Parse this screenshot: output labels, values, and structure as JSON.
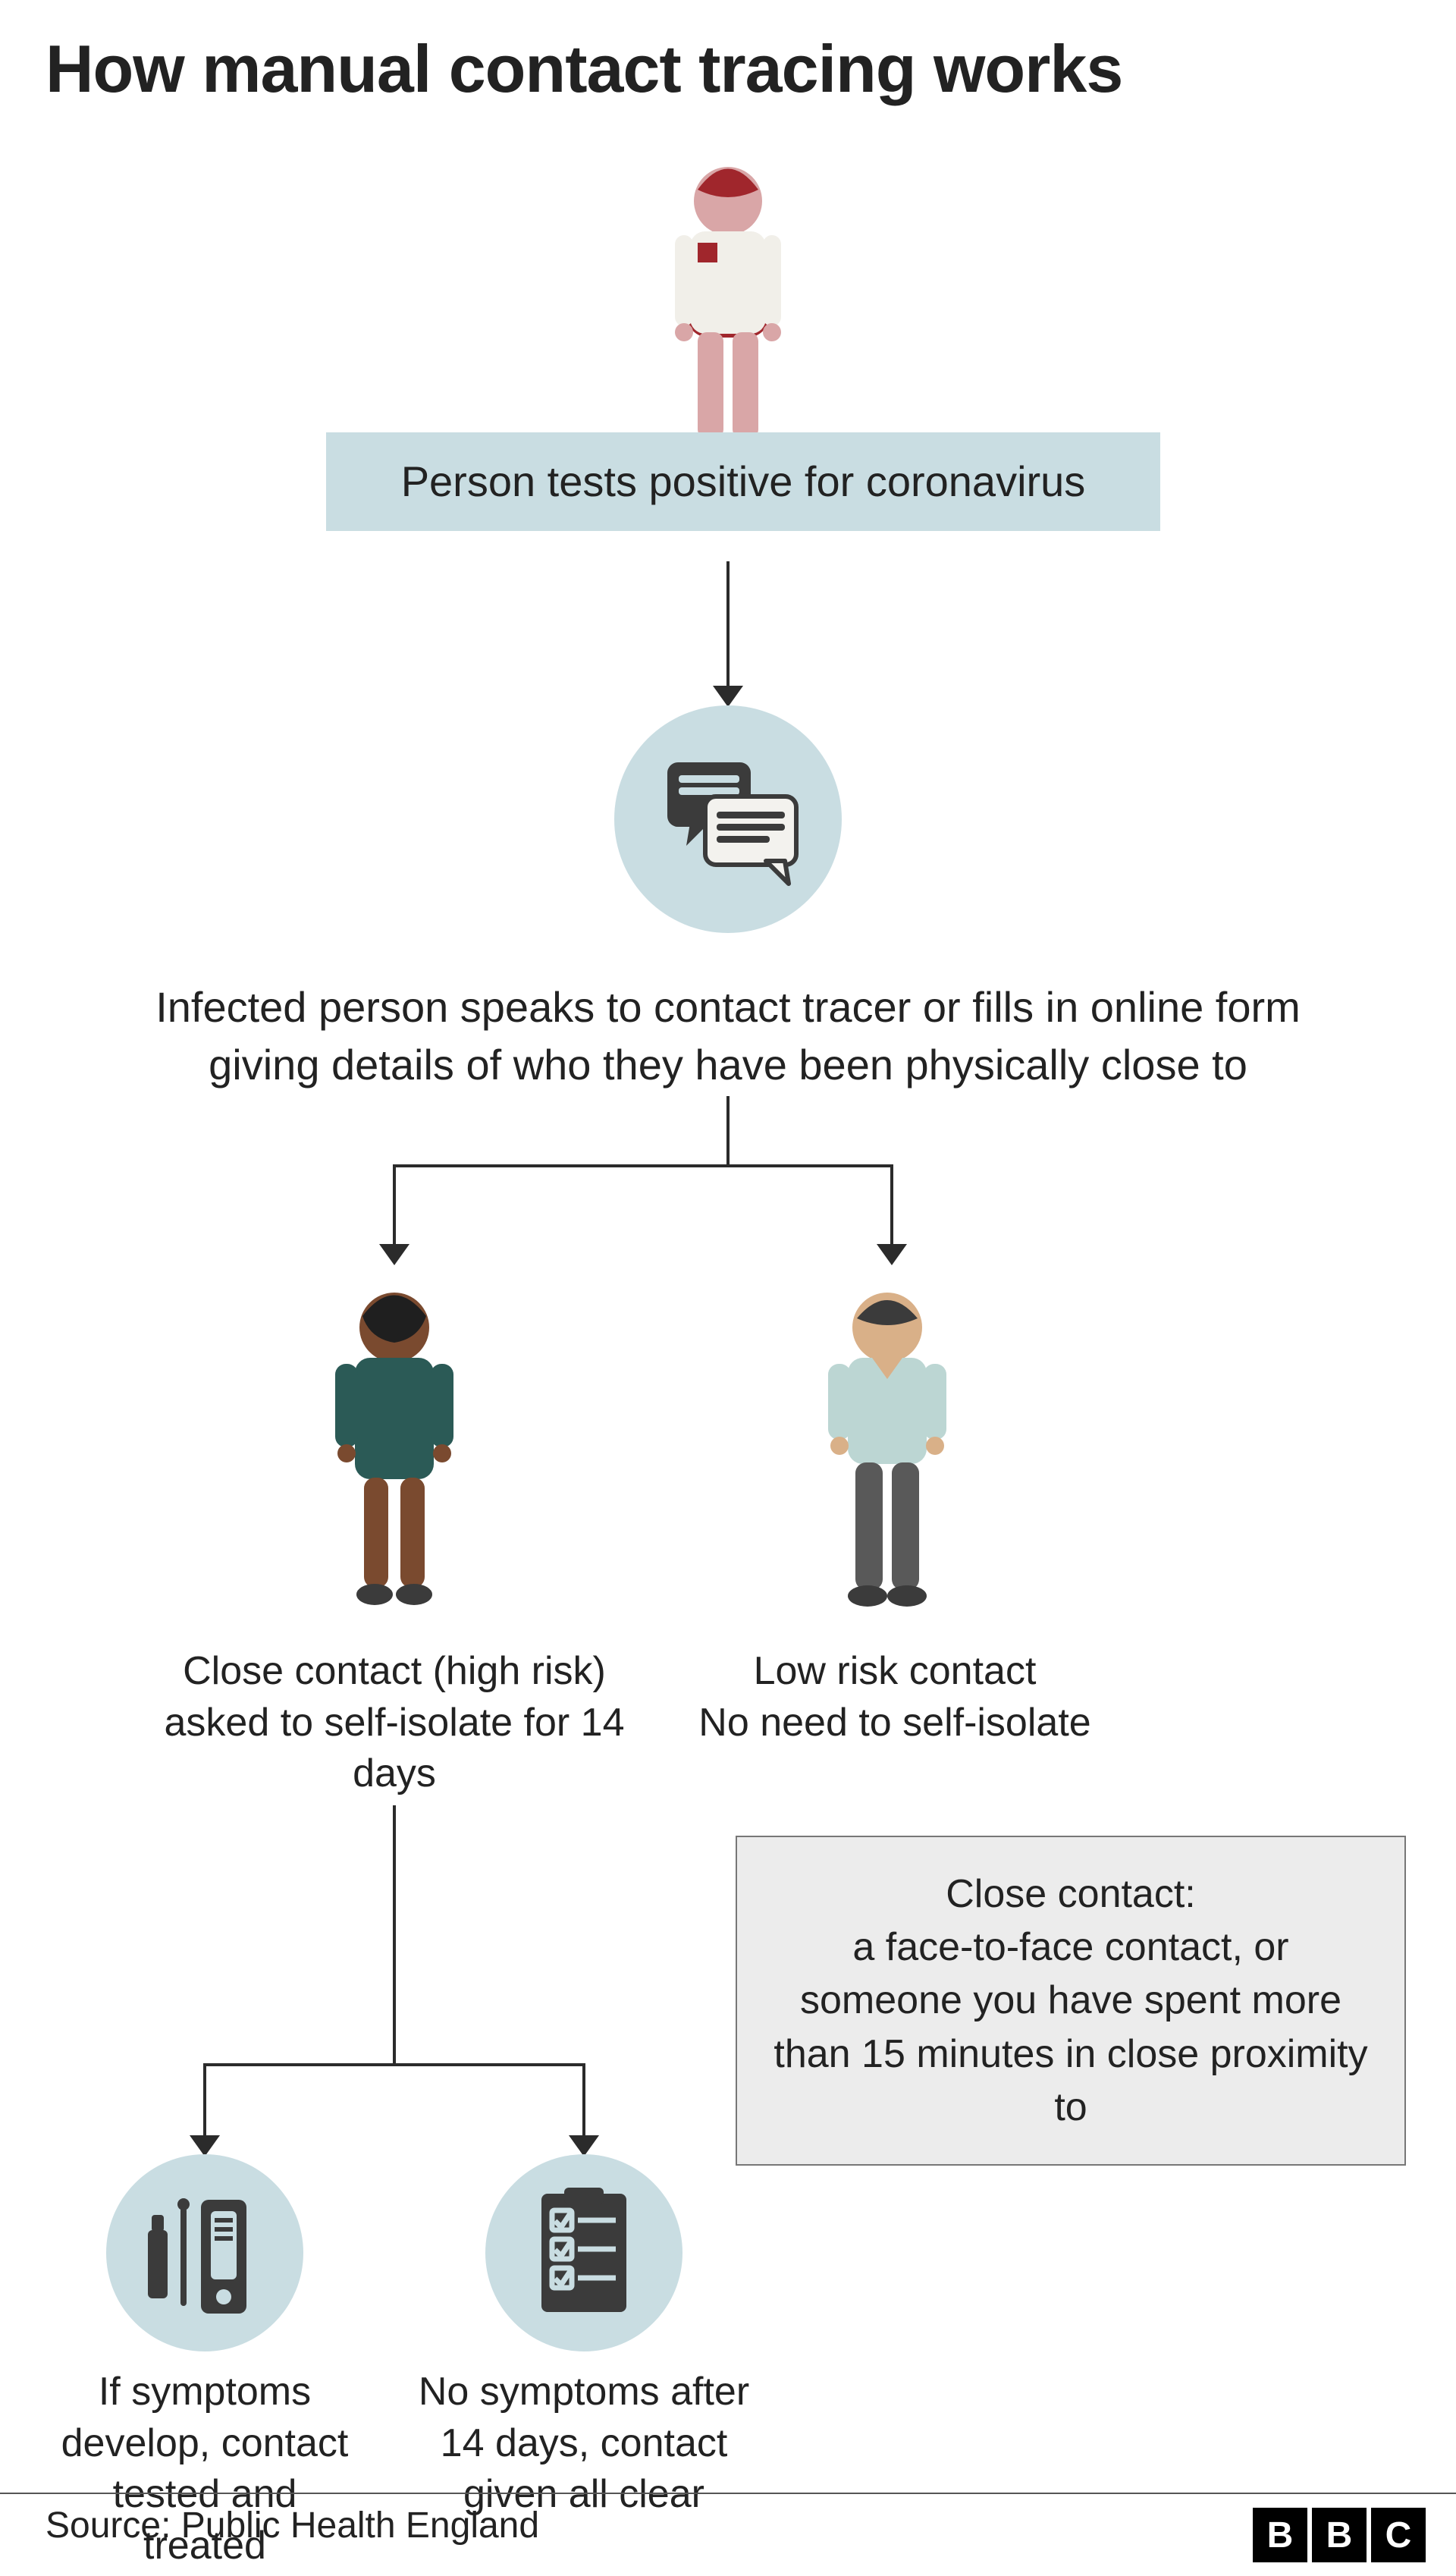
{
  "colors": {
    "background": "#ffffff",
    "accent_box": "#c9dde2",
    "circle_bg": "#c9dde2",
    "infected_dark": "#a0262c",
    "infected_light": "#d9a6a7",
    "woman_skin": "#7a4a2f",
    "woman_dress": "#2b5a56",
    "man_skin": "#d9b088",
    "man_shirt": "#bcd6d3",
    "man_pants": "#595959",
    "icon_dark": "#3b3b3b",
    "arrow": "#2b2b2b",
    "def_box_bg": "#ececec"
  },
  "title": "How manual contact tracing works",
  "step1": "Person tests positive for coronavirus",
  "step2": "Infected person speaks to contact tracer or fills in online form giving details of who they have been physically close to",
  "branches": {
    "high_risk": "Close contact (high risk) asked to self-isolate for 14 days",
    "low_risk_line1": "Low risk contact",
    "low_risk_line2": "No need to self-isolate"
  },
  "definition": "Close contact:\na face-to-face contact, or someone you have spent more than 15 minutes in close proximity to",
  "outcomes": {
    "symptoms": "If symptoms develop, contact tested and treated",
    "no_symptoms": "No symptoms after 14 days, contact given all clear"
  },
  "source_label": "Source: Public Health England",
  "bbc_letters": [
    "B",
    "B",
    "C"
  ]
}
